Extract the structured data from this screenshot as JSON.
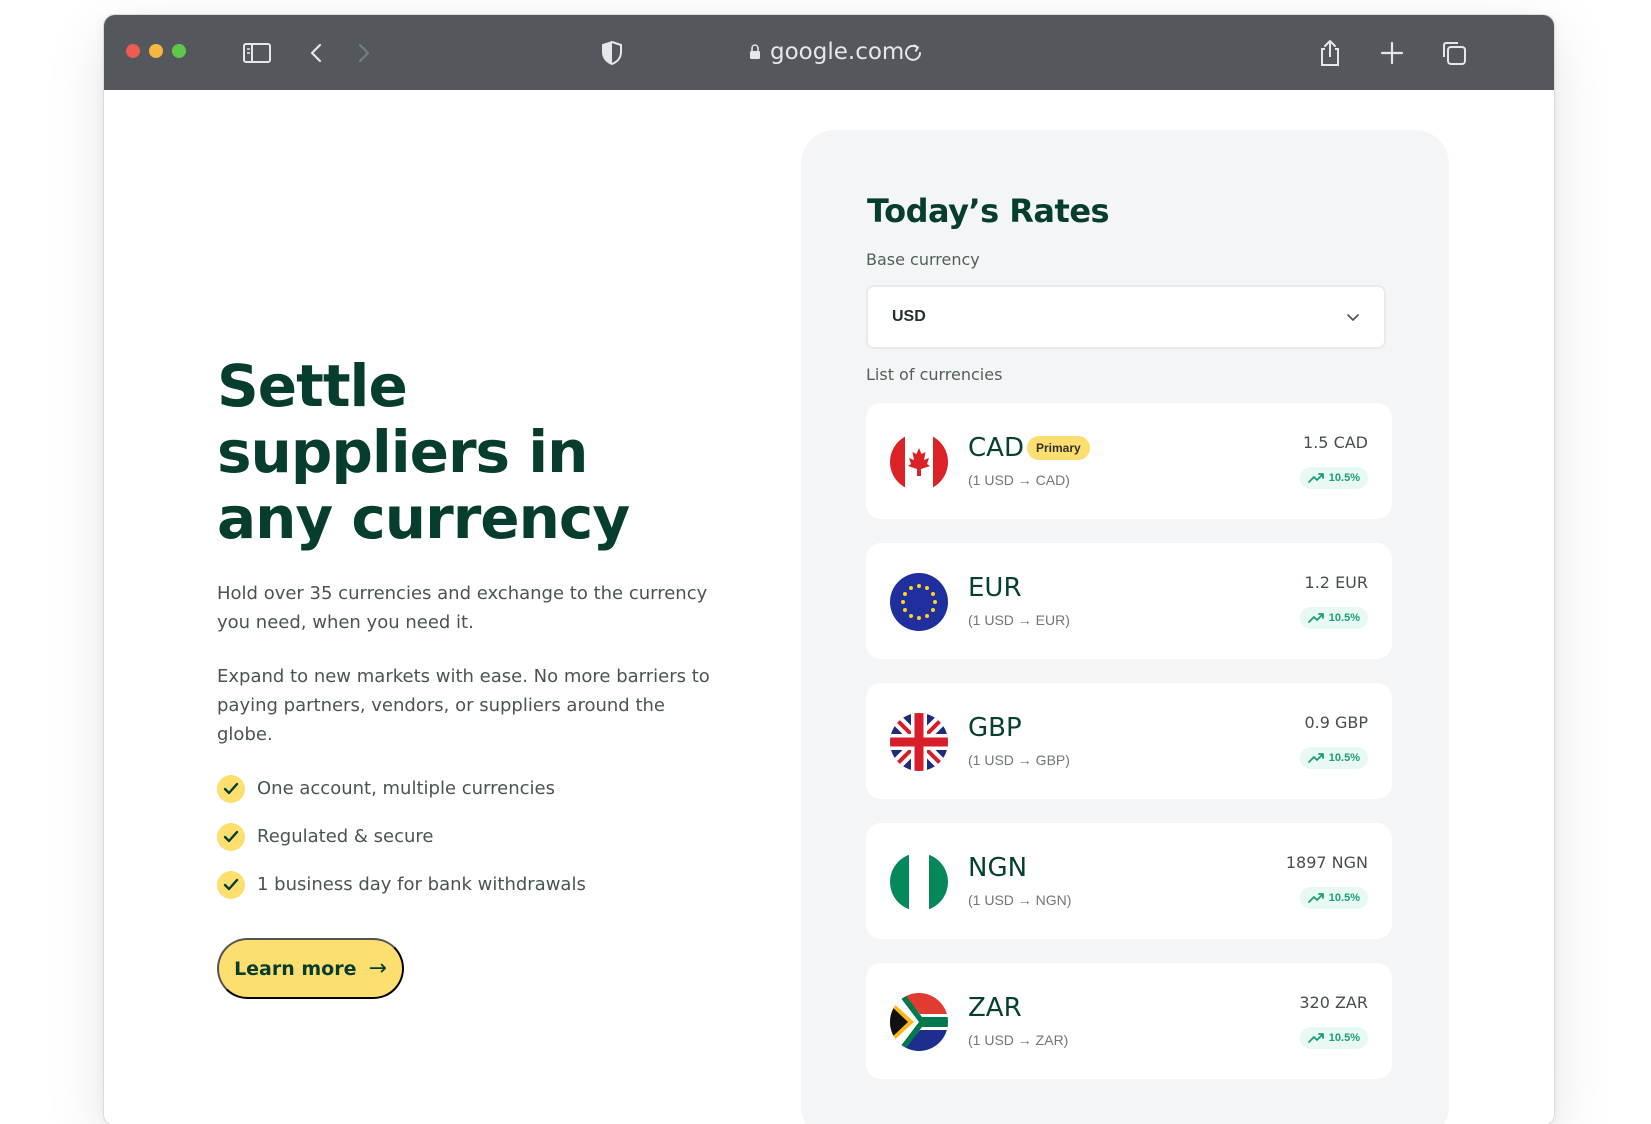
{
  "browser": {
    "address": "google.com",
    "icons": [
      "sidebar-icon",
      "back-icon",
      "forward-icon",
      "shield-icon",
      "lock-icon",
      "reload-icon",
      "share-icon",
      "new-tab-icon",
      "tabs-icon"
    ]
  },
  "hero": {
    "headline": "Settle suppliers in any currency",
    "paragraph_1": "Hold over 35 currencies and exchange to the currency you need, when you need it.",
    "paragraph_2": "Expand to new markets with ease. No more barriers to paying partners, vendors, or suppliers around the globe.",
    "features": [
      {
        "label": "One account, multiple currencies",
        "icon": "check-icon"
      },
      {
        "label": "Regulated & secure",
        "icon": "check-icon"
      },
      {
        "label": "1 business day for bank withdrawals",
        "icon": "check-icon"
      }
    ],
    "cta_label": "Learn more",
    "cta_icon": "arrow-right-icon"
  },
  "rates": {
    "title": "Today’s Rates",
    "base_currency_label": "Base currency",
    "base_currency_value": "USD",
    "list_label": "List of currencies",
    "currencies": [
      {
        "code": "CAD",
        "badge": "Primary",
        "conversion": "(1 USD → CAD)",
        "amount": "1.5 CAD",
        "change": "10.5%",
        "flag": "canada-flag-icon"
      },
      {
        "code": "EUR",
        "conversion": "(1 USD → EUR)",
        "amount": "1.2 EUR",
        "change": "10.5%",
        "flag": "eu-flag-icon"
      },
      {
        "code": "GBP",
        "conversion": "(1 USD → GBP)",
        "amount": "0.9 GBP",
        "change": "10.5%",
        "flag": "uk-flag-icon"
      },
      {
        "code": "NGN",
        "conversion": "(1 USD → NGN)",
        "amount": "1897 NGN",
        "change": "10.5%",
        "flag": "nigeria-flag-icon"
      },
      {
        "code": "ZAR",
        "conversion": "(1 USD → ZAR)",
        "amount": "320 ZAR",
        "change": "10.5%",
        "flag": "south-africa-flag-icon"
      }
    ]
  },
  "colors": {
    "dark_green": "#063d2f",
    "accent_yellow": "#fddf6f",
    "panel_gray": "#f4f5f6",
    "positive_green": "#1d9c78"
  }
}
